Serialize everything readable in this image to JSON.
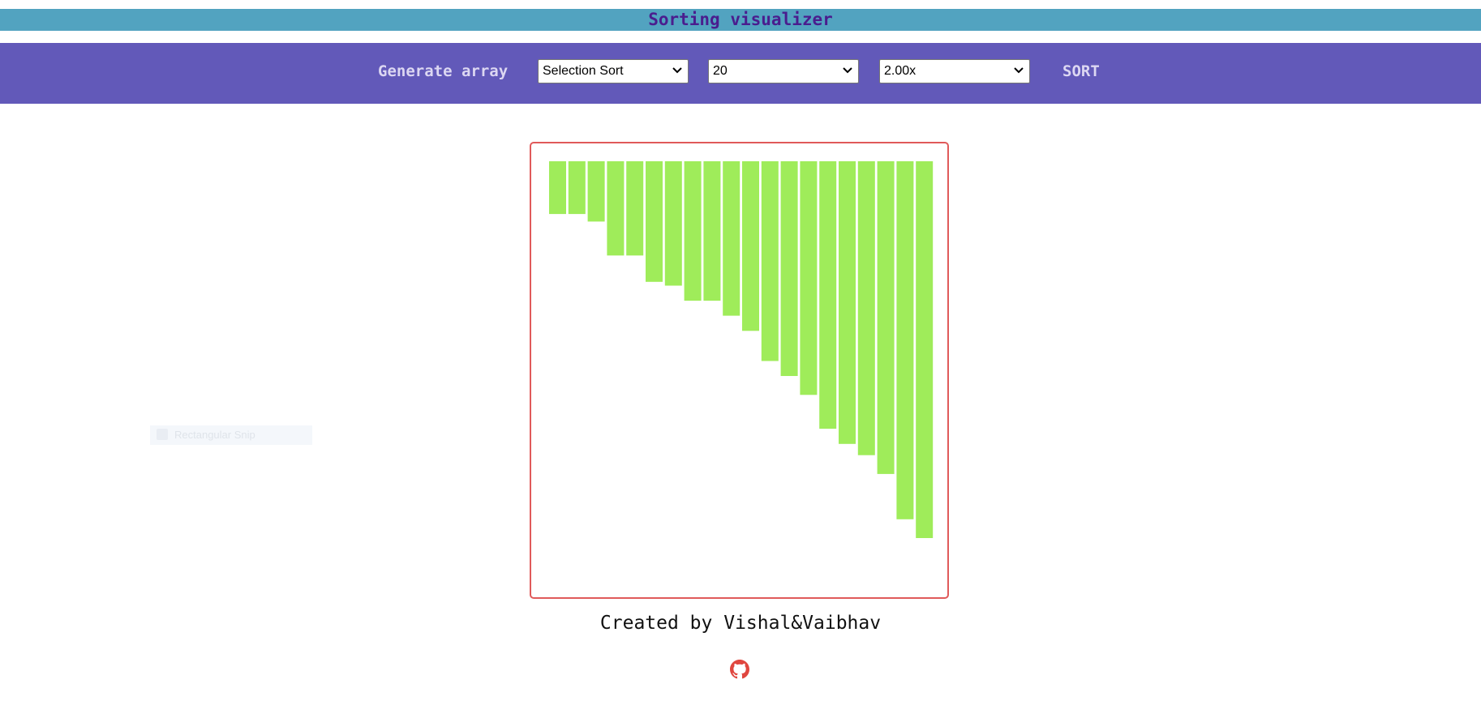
{
  "header": {
    "title": "Sorting visualizer"
  },
  "toolbar": {
    "generate_label": "Generate array",
    "algorithm": {
      "selected": "Selection Sort"
    },
    "array_size": {
      "selected": "20"
    },
    "speed": {
      "selected": "2.00x"
    },
    "sort_label": "SORT"
  },
  "chart_data": {
    "type": "bar",
    "values": [
      14,
      14,
      16,
      25,
      25,
      32,
      33,
      37,
      37,
      41,
      45,
      53,
      57,
      62,
      71,
      75,
      78,
      83,
      95,
      100
    ],
    "bar_color": "#9fec5a",
    "ylim": [
      0,
      100
    ]
  },
  "ghost_tooltip": {
    "label": "Rectangular Snip"
  },
  "footer": {
    "credit": "Created by Vishal&Vaibhav",
    "github_icon": "github-icon"
  },
  "colors": {
    "title_bar": "#52a3c0",
    "title_text": "#4a1d8e",
    "toolbar": "#6259b9",
    "toolbar_text": "#dcd7f2",
    "chart_border": "#e05a5a",
    "github": "#e0473f"
  }
}
